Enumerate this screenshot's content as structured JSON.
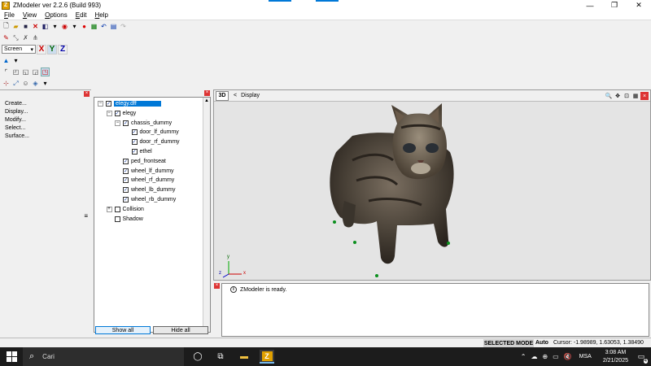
{
  "window": {
    "title": "ZModeler ver 2.2.6 (Build 993)",
    "app_icon": "Z",
    "controls": [
      "—",
      "❐",
      "✕"
    ]
  },
  "menu": [
    "File",
    "View",
    "Options",
    "Edit",
    "Help"
  ],
  "toolbar": {
    "view_mode": "Screen",
    "axes": [
      "X",
      "Y",
      "Z"
    ]
  },
  "command_panel": {
    "items": [
      "Create...",
      "Display...",
      "Modify...",
      "Select...",
      "Surface..."
    ],
    "close_glyph": "×"
  },
  "hierarchy": {
    "close_glyph": "×",
    "nodes": [
      {
        "label": "elegy.dff",
        "checked": true,
        "selected": true,
        "expander": "−",
        "level": 0
      },
      {
        "label": "elegy",
        "checked": true,
        "expander": "−",
        "level": 1
      },
      {
        "label": "chassis_dummy",
        "checked": true,
        "expander": "−",
        "level": 2
      },
      {
        "label": "door_lf_dummy",
        "checked": true,
        "level": 3
      },
      {
        "label": "door_rf_dummy",
        "checked": true,
        "level": 3
      },
      {
        "label": "ethel",
        "checked": true,
        "level": 3
      },
      {
        "label": "ped_frontseat",
        "checked": true,
        "level": 2
      },
      {
        "label": "wheel_lf_dummy",
        "checked": true,
        "level": 2
      },
      {
        "label": "wheel_rf_dummy",
        "checked": true,
        "level": 2
      },
      {
        "label": "wheel_lb_dummy",
        "checked": true,
        "level": 2
      },
      {
        "label": "wheel_rb_dummy",
        "checked": true,
        "level": 2
      },
      {
        "label": "Collision",
        "checked": false,
        "expander": "+",
        "level": 1
      },
      {
        "label": "Shadow",
        "checked": false,
        "level": 1
      }
    ],
    "show_all_label": "Show all",
    "hide_all_label": "Hide all"
  },
  "viewport": {
    "mode": "3D",
    "arrow": "<",
    "title": "Display",
    "axis_x": "x",
    "axis_y": "y",
    "axis_z": "z",
    "tool_icons": [
      "zoom-icon",
      "pan-icon",
      "fit-icon",
      "grid-icon",
      "close-icon"
    ]
  },
  "console": {
    "message": "ZModeler is ready.",
    "info_glyph": "i",
    "close_glyph": "×"
  },
  "statusbar": {
    "mode": "SELECTED MODE",
    "auto": "Auto",
    "cursor": "Cursor: -1.98989, 1.63053, 1.38490"
  },
  "taskbar": {
    "search_placeholder": "Cari",
    "language": "MSA",
    "time": "3:08 AM",
    "date": "2/21/2025",
    "notification_count": "4"
  },
  "colors": {
    "selection": "#0078d7",
    "close_red": "#dd3333",
    "dummy_green": "#0b8f1d"
  }
}
